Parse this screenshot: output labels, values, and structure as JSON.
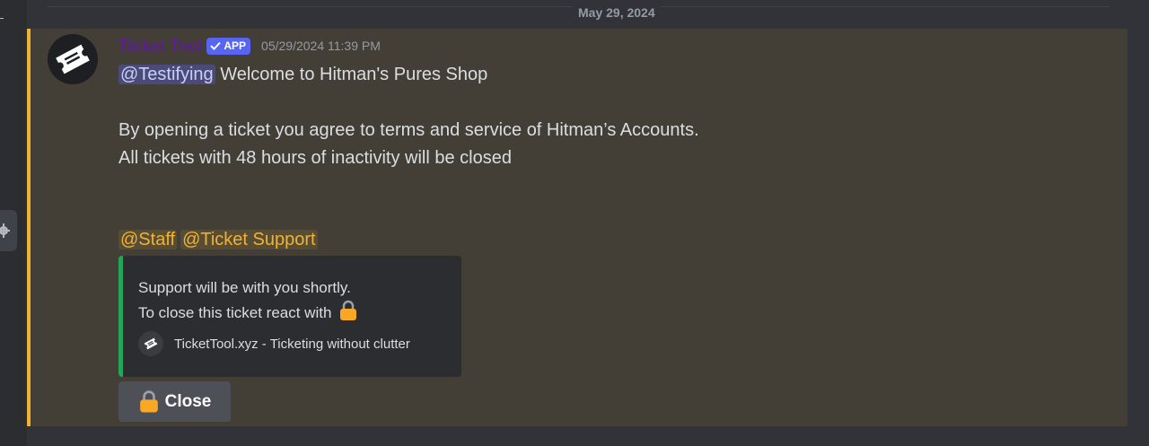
{
  "date_divider": "May 29, 2024",
  "message": {
    "author": "Ticket Tool",
    "badge": "APP",
    "timestamp": "05/29/2024 11:39 PM",
    "mention_user": "@Testifying",
    "line1_rest": " Welcome to Hitman's Pures Shop",
    "line2": "By opening a ticket you agree to terms and service of Hitman’s Accounts.",
    "line3": "All tickets with 48 hours of inactivity will be closed",
    "role_mentions": [
      "@Staff",
      "@Ticket Support"
    ]
  },
  "embed": {
    "description_line1": "Support will be with you shortly.",
    "description_line2": "To close this ticket react with",
    "footer_text": "TicketTool.xyz - Ticketing without clutter",
    "accent_color": "#23a55a"
  },
  "close_button": {
    "label": "Close",
    "icon": "lock-icon"
  },
  "colors": {
    "highlight_bar": "#f0b232",
    "highlight_bg": "#433f37",
    "app_badge": "#5865f2",
    "username": "#5b1f8f"
  }
}
